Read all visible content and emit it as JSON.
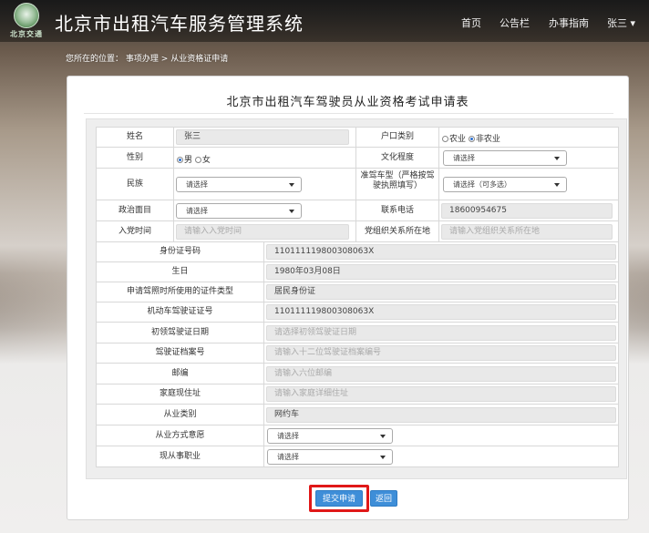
{
  "header": {
    "logo_text": "北京交通",
    "site_title": "北京市出租汽车服务管理系统",
    "nav": [
      {
        "label": "首页"
      },
      {
        "label": "公告栏"
      },
      {
        "label": "办事指南"
      },
      {
        "label": "张三 ▾"
      }
    ]
  },
  "breadcrumb": {
    "prefix": "您所在的位置：",
    "path": [
      "事项办理",
      "从业资格证申请"
    ],
    "separator": ">"
  },
  "form": {
    "title": "北京市出租汽车驾驶员从业资格考试申请表",
    "name_label": "姓名",
    "name_value": "张三",
    "hukou_label": "户口类别",
    "hukou_options": [
      "农业",
      "非农业"
    ],
    "hukou_selected": "非农业",
    "gender_label": "性别",
    "gender_options": [
      "男",
      "女"
    ],
    "gender_selected": "男",
    "education_label": "文化程度",
    "education_value": "请选择",
    "ethnicity_label": "民族",
    "ethnicity_value": "请选择",
    "vehicle_label": "准驾车型（严格按驾驶执照填写）",
    "vehicle_value": "请选择（可多选）",
    "politics_label": "政治面目",
    "politics_value": "请选择",
    "phone_label": "联系电话",
    "phone_value": "18600954675",
    "party_time_label": "入党时间",
    "party_time_placeholder": "请输入入党时间",
    "party_org_label": "党组织关系所在地",
    "party_org_placeholder": "请输入党组织关系所在地",
    "id_label": "身份证号码",
    "id_value": "110111119800308063X",
    "birth_label": "生日",
    "birth_value": "1980年03月08日",
    "cert_type_label": "申请驾照时所使用的证件类型",
    "cert_type_value": "居民身份证",
    "license_no_label": "机动车驾驶证证号",
    "license_no_value": "110111119800308063X",
    "first_date_label": "初领驾驶证日期",
    "first_date_placeholder": "请选择初领驾驶证日期",
    "archive_label": "驾驶证档案号",
    "archive_placeholder": "请输入十二位驾驶证档案编号",
    "zip_label": "邮编",
    "zip_placeholder": "请输入六位邮编",
    "address_label": "家庭现住址",
    "address_placeholder": "请输入家庭详细住址",
    "category_label": "从业类别",
    "category_value": "网约车",
    "mode_label": "从业方式意愿",
    "mode_value": "请选择",
    "job_label": "现从事职业",
    "job_value": "请选择"
  },
  "actions": {
    "submit": "提交申请",
    "back": "返回",
    "highlight_color": "#e01818",
    "button_color": "#3e8ed8"
  }
}
